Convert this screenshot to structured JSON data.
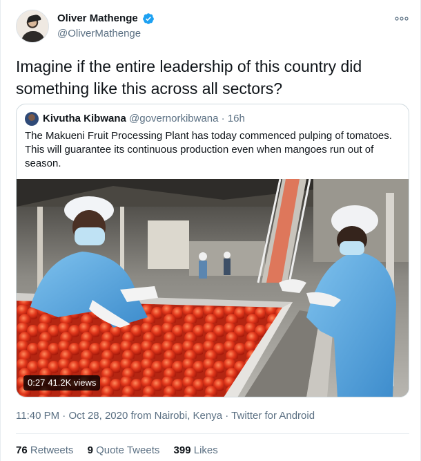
{
  "author": {
    "display_name": "Oliver Mathenge",
    "handle": "@OliverMathenge",
    "verified": true
  },
  "more_icon": "more-dots-icon",
  "tweet_text": "Imagine if the entire leadership of this country did something like this across all sectors?",
  "quoted": {
    "display_name": "Kivutha Kibwana",
    "handle": "@governorkibwana",
    "separator": "·",
    "time": "16h",
    "text": "The Makueni Fruit Processing Plant has today commenced pulping of tomatoes. This will guarantee its continuous production even when mangoes run out of season.",
    "video": {
      "duration": "0:27",
      "views": "41.2K views"
    }
  },
  "meta": {
    "time": "11:40 PM",
    "separator1": "·",
    "date": "Oct 28, 2020",
    "location": "from Nairobi, Kenya",
    "separator2": "·",
    "source": "Twitter for Android"
  },
  "stats": {
    "retweets_count": "76",
    "retweets_label": "Retweets",
    "quote_count": "9",
    "quote_label": "Quote Tweets",
    "likes_count": "399",
    "likes_label": "Likes"
  },
  "colors": {
    "verified_blue": "#1da1f2",
    "secondary_text": "#5b7083",
    "tomato_red": "#e2381c"
  }
}
